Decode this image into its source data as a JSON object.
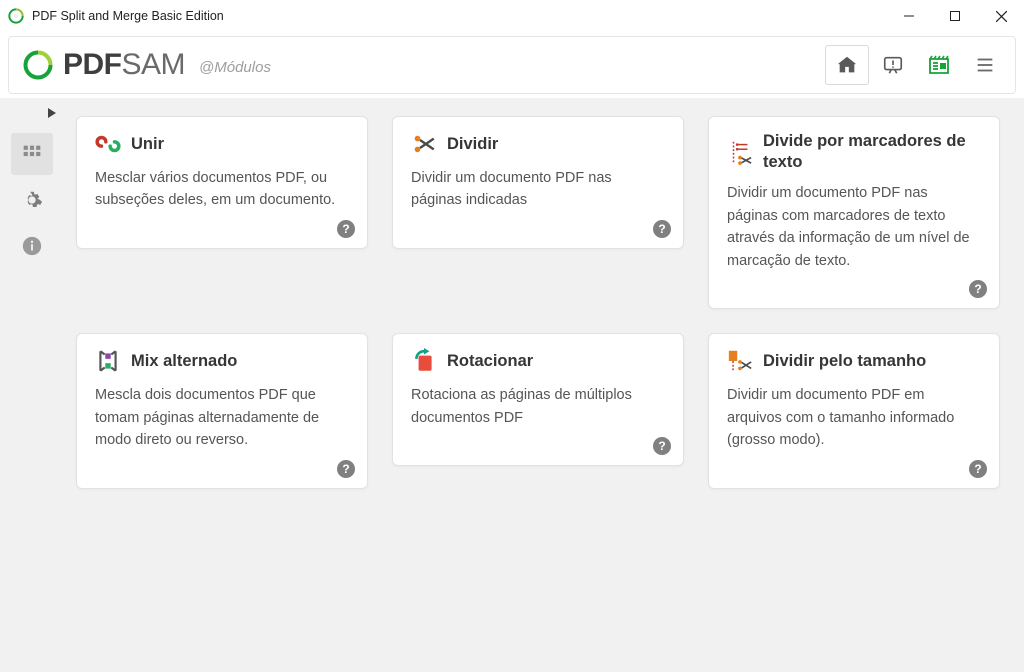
{
  "window": {
    "title": "PDF Split and Merge Basic Edition"
  },
  "brand": {
    "pdf": "PDF",
    "sam": "SAM",
    "subtitle": "@Módulos"
  },
  "modules": [
    {
      "id": "merge",
      "title": "Unir",
      "desc": "Mesclar vários documentos PDF, ou subseções deles, em um documento."
    },
    {
      "id": "split",
      "title": "Dividir",
      "desc": "Dividir um documento PDF nas páginas indicadas"
    },
    {
      "id": "split-bookmarks",
      "title": "Divide por marcadores de texto",
      "desc": "Dividir um documento PDF nas páginas com marcadores de texto através da informação de um nível de marcação de texto."
    },
    {
      "id": "alt-mix",
      "title": "Mix alternado",
      "desc": "Mescla dois documentos PDF que tomam páginas alternadamente de modo direto ou reverso."
    },
    {
      "id": "rotate",
      "title": "Rotacionar",
      "desc": "Rotaciona as páginas de múltiplos documentos PDF"
    },
    {
      "id": "split-size",
      "title": "Dividir pelo tamanho",
      "desc": "Dividir um documento PDF em arquivos com o tamanho informado (grosso modo)."
    }
  ]
}
